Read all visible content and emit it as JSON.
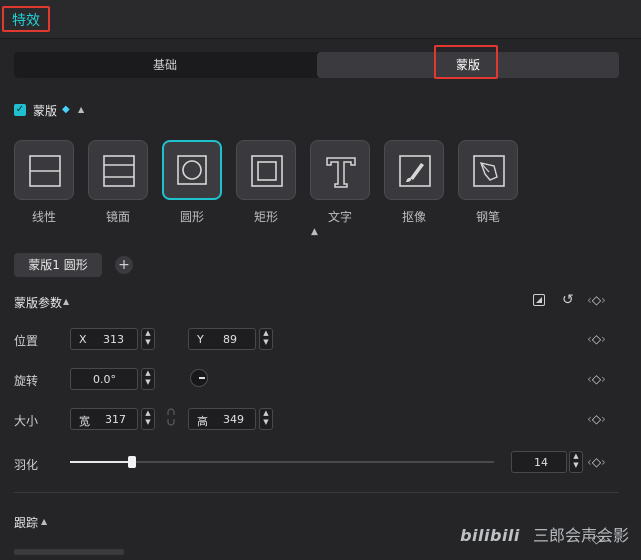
{
  "header": {
    "title": "特效"
  },
  "tabs": [
    {
      "label": "基础",
      "active": false
    },
    {
      "label": "蒙版",
      "active": true
    }
  ],
  "mask_section": {
    "title": "蒙版",
    "checked": true,
    "premium_icon": "diamond-icon"
  },
  "mask_types": [
    {
      "label": "线性",
      "icon": "linear-mask-icon"
    },
    {
      "label": "镜面",
      "icon": "mirror-mask-icon"
    },
    {
      "label": "圆形",
      "icon": "circle-mask-icon",
      "selected": true
    },
    {
      "label": "矩形",
      "icon": "rectangle-mask-icon"
    },
    {
      "label": "文字",
      "icon": "text-mask-icon"
    },
    {
      "label": "抠像",
      "icon": "cutout-brush-icon"
    },
    {
      "label": "钢笔",
      "icon": "pen-tool-icon"
    }
  ],
  "active_mask_pill": "蒙版1 圆形",
  "params": {
    "title": "蒙版参数",
    "position": {
      "label": "位置",
      "x_prefix": "X",
      "x": "313",
      "y_prefix": "Y",
      "y": "89"
    },
    "rotation": {
      "label": "旋转",
      "value": "0.0°"
    },
    "size": {
      "label": "大小",
      "w_prefix": "宽",
      "w": "317",
      "h_prefix": "高",
      "h": "349"
    },
    "feather": {
      "label": "羽化",
      "value": "14",
      "level_fraction": 0.14
    }
  },
  "tracking": {
    "title": "跟踪"
  },
  "watermark": {
    "logo": "bilibili",
    "text": "三郎会声会影"
  },
  "colors": {
    "accent": "#1fd1d6",
    "highlight_box": "#e1382f",
    "background": "#252528"
  }
}
